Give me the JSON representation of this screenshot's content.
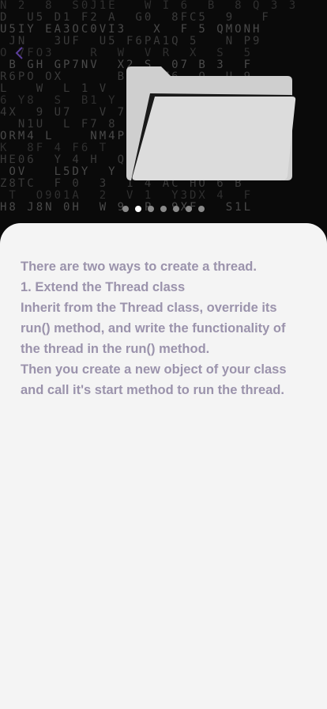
{
  "hero": {
    "icons": {
      "back": "chevron-left-icon",
      "illustration": "folder-icon"
    },
    "pager": {
      "total": 7,
      "active_index": 1
    },
    "matrix_lines": [
      "N 2  8  S0J1E   W I 6  B  8 Q 3 3",
      "D  U5 D1 F2 A  G0  8FC5  9   F",
      "U5IY EA3OC0VI3   X  F 5 QMONH",
      " JN   3UF  U5 F6PA1Q 5   N P9",
      "O 7FO3    R  W  V R  X  S  5",
      " B GH GP7NV  X2 S  07 B 3  F",
      "R6PO OX      B  0DZ6  O  U 9",
      "L   W  L 1 V   J H  S Y4VW 1",
      "6 Y8  S  B1 Y  I  0  A I  C4",
      "4X  9 U7   V 7  Y  X 2   IE2",
      "  N1U  L F7 8  K  I  9ZJ6 I",
      "ORM4 L    NM4PH1 L  O  3Q S1",
      "K  8F 4 F6 T  TN 1Y H4 P  2",
      "HE06  Y 4 H  Q8 3Z1 T  P 9",
      " OV   L5DY  Y 9 JK  YC1ZF  V",
      "Z8TC  F 0  3  1 4 AC HO 6 B",
      " T  O901A  2  V 1  Y3DX 4  F",
      "H8 J8N 0H  W 9  P  9XF   S1L"
    ]
  },
  "content": {
    "paragraphs": [
      "There are two ways to create a thread.",
      "1. Extend the Thread class",
      "Inherit from the Thread class, override its run() method, and write the functionality of the thread in the run() method.",
      "Then you create a new object of your class and call it's start method to run the thread."
    ]
  },
  "colors": {
    "sheet_background": "#f4f4f4",
    "text": "#9b93ac",
    "hero_background": "#0a0a0a",
    "dot_active": "#ffffff",
    "dot_inactive": "#8a8a8a"
  }
}
